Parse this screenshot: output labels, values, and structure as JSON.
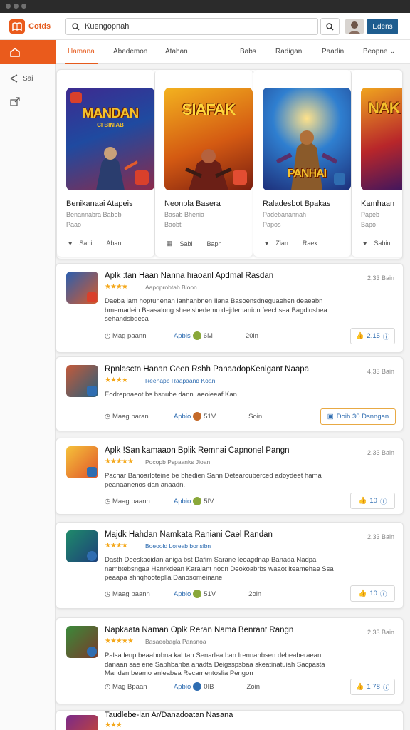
{
  "app": {
    "title": "Cotds",
    "search_value": "Kuengopnah",
    "action_button": "Edens"
  },
  "sidebar": {
    "items": [
      {
        "label": "Sai"
      },
      {
        "label": ""
      }
    ]
  },
  "tabs": [
    {
      "label": "Hamana",
      "active": true
    },
    {
      "label": "Abedemon"
    },
    {
      "label": "Atahan"
    },
    {
      "label": "Babs"
    },
    {
      "label": "Radigan"
    },
    {
      "label": "Paadin"
    },
    {
      "label": "Beopne"
    }
  ],
  "featured": [
    {
      "art_title": "MANDAN",
      "art_sub": "CI BINIAB",
      "title": "Benikanaai Atapeis",
      "sub1": "Benannabra Babeb",
      "sub2": "Paao",
      "stat": "Sabi",
      "action": "Aban"
    },
    {
      "art_title": "SIAFAK",
      "art_sub": "",
      "title": "Neonpla Basera",
      "sub1": "Basab Bhenia",
      "sub2": "Baobt",
      "stat": "Sabi",
      "action": "Bapn"
    },
    {
      "art_title": "PANHAI",
      "art_sub": "",
      "title": "Raladesbot Bpakas",
      "sub1": "Padebanannah",
      "sub2": "Papos",
      "stat": "Zian",
      "action": "Raek"
    },
    {
      "art_title": "NAK",
      "art_sub": "",
      "title": "Kamhaan",
      "sub1": "Papeb",
      "sub2": "Bapo",
      "stat": "Sabin",
      "action": ""
    }
  ],
  "list": [
    {
      "title": "Aplk :tan Haan Nanna hiaoanl Apdmal Rasdan",
      "time": "2,33 Bain",
      "rating": "★★★★",
      "meta": "Aapoprobtab Bloon",
      "desc": "Daeba lam hoptunenan lanhanbnen Iiana Basoensdneguaehen deaeabn bmemadein Baasalong sheeisbedemo dejdemanion feechsea Bagdiosbea sehandsbdeca",
      "author": "Mag paann",
      "app": "Apbis",
      "size": "6M",
      "date": "20in",
      "likes": "2.15"
    },
    {
      "title": "Rpnlasctn Hanan Ceen Rshh PanaadopKenlgant Naapa",
      "time": "4,33 Bain",
      "rating": "★★★★",
      "meta": "Reenapb Raapaand Koan",
      "desc": "Eodrepnaeot bs bsnube dann Iaeoieeaf Kan",
      "author": "Maag paran",
      "app": "Apbio",
      "size": "51V",
      "date": "Soin",
      "likes": "Doih 30 Dsnngan"
    },
    {
      "title": "Aplk !San kamaaon Bplik Remnai Capnonel Pangn",
      "time": "2,33 Bain",
      "rating": "★★★★★",
      "meta": "Pocopb Pspaanks Jioan",
      "desc": "Pachar Banoarloteine be bhedien Sann Detearouberced adoydeet hama peanaanenos dan anaadn.",
      "author": "Maag paann",
      "app": "Apbio",
      "size": "5IV",
      "date": "",
      "likes": "10"
    },
    {
      "title": "Majdk Hahdan Namkata Raniani Cael Randan",
      "time": "2,33 Bain",
      "rating": "★★★★",
      "meta": "Boeoold Loreab bonsibn",
      "desc": "Dasth Deeskacidan aniga bst Dafim Sarane leoagdnap Banada Nadpa nambtebsngaa Hanrkdean Karalant nodn Deokoabrbs waaot lteamehae Ssa peaapa shnqhooteplla Danosomeinane",
      "author": "Maag paann",
      "app": "Apbio",
      "size": "51V",
      "date": "2oin",
      "likes": "10"
    },
    {
      "title": "Napkaata Naman Oplk Reran Nama Benrant Rangn",
      "time": "2,33 Bain",
      "rating": "★★★★★",
      "meta": "Basaeobagla Pansnoa",
      "desc": "Palsa lenp beaabobna kahtan Senarlea ban Irennanbsen debeaberaean danaan sae ene Saphbanba anadta Deigsspsbaa skeatinatuiah Sacpasta Manden beamo anleabea Recamentoslia Pengon",
      "author": "Mag Bpaan",
      "app": "Apbio",
      "size": "0IB",
      "date": "Zoin",
      "likes": "1 78"
    },
    {
      "title": "Taudlebe-lan Ar/Danadoatan Nasana",
      "time": "",
      "rating": "★★★",
      "meta": "",
      "desc": "",
      "author": "",
      "app": "",
      "size": "",
      "date": "",
      "likes": ""
    }
  ]
}
